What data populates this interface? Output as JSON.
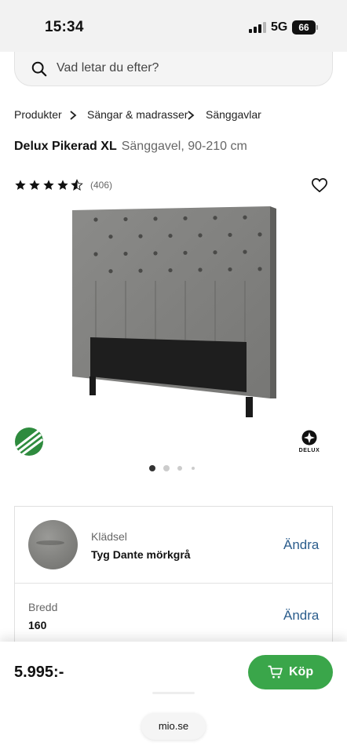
{
  "status_bar": {
    "time": "15:34",
    "network": "5G",
    "battery": "66"
  },
  "search": {
    "placeholder": "Vad letar du efter?"
  },
  "breadcrumb": [
    "Produkter",
    "Sängar & madrasser",
    "Sänggavlar"
  ],
  "product": {
    "name": "Delux Pikerad XL",
    "subtitle": "Sänggavel, 90-210 cm",
    "rating": 4.5,
    "reviews": "(406)",
    "brand_logo_text": "DELUX",
    "image_page": 1,
    "image_pages": 4
  },
  "options": [
    {
      "label": "Klädsel",
      "value": "Tyg Dante mörkgrå",
      "action": "Ändra"
    },
    {
      "label": "Bredd",
      "value": "160",
      "action": "Ändra"
    }
  ],
  "purchase": {
    "price": "5.995:-",
    "buy_label": "Köp"
  },
  "browser": {
    "url": "mio.se"
  },
  "colors": {
    "accent_green": "#3aa64a",
    "link_blue": "#2b5d8c",
    "fabric_grey": "#858582"
  }
}
